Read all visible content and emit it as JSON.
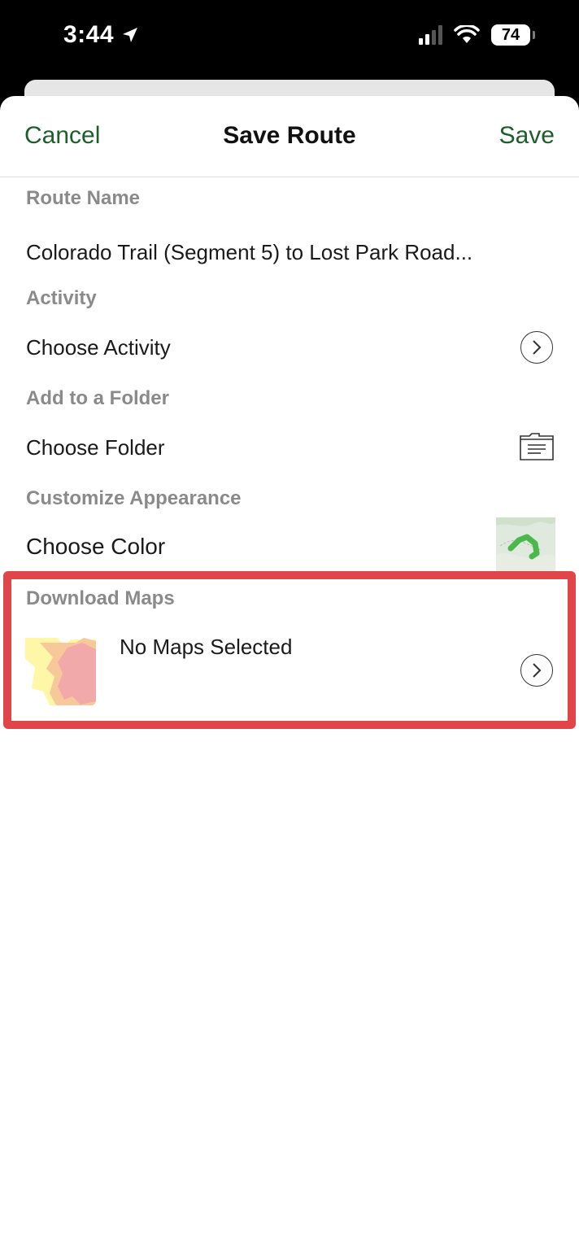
{
  "status_bar": {
    "time": "3:44",
    "battery": "74"
  },
  "nav": {
    "cancel_label": "Cancel",
    "title": "Save Route",
    "save_label": "Save"
  },
  "route_name": {
    "label": "Route Name",
    "value": "Colorado Trail (Segment 5) to Lost Park Road..."
  },
  "activity": {
    "label": "Activity",
    "value": "Choose Activity"
  },
  "folder": {
    "label": "Add to a Folder",
    "value": "Choose Folder"
  },
  "appearance": {
    "label": "Customize Appearance",
    "value": "Choose Color"
  },
  "download_maps": {
    "label": "Download Maps",
    "value": "No Maps Selected",
    "highlight_color": "#e0454a"
  },
  "colors": {
    "accent": "#1f5e2c",
    "route_color": "#4cb84c"
  }
}
